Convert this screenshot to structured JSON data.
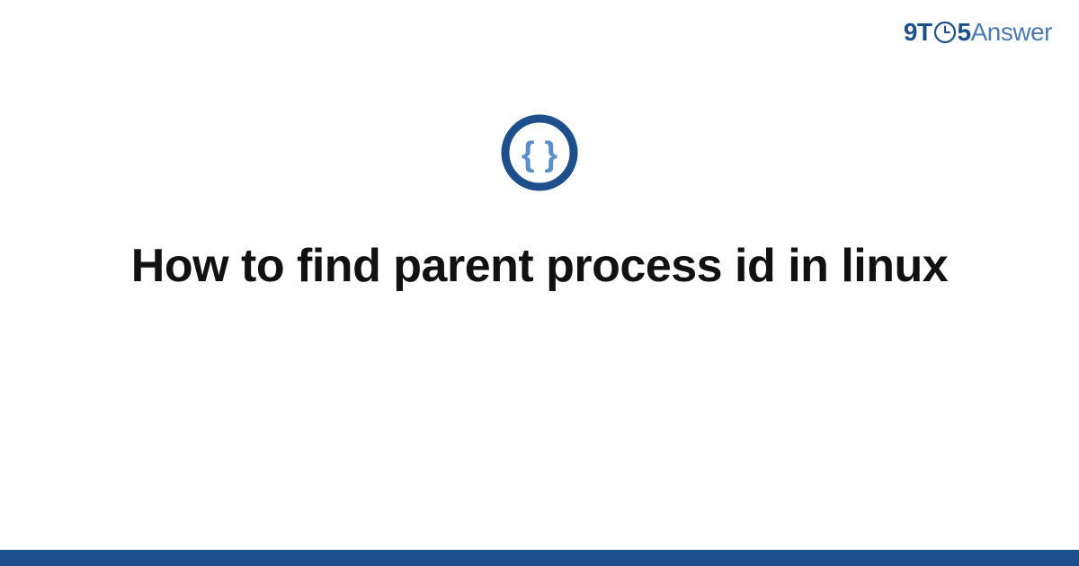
{
  "brand": {
    "part1": "9T",
    "part2": "5",
    "part3": "Answer"
  },
  "icon": {
    "name": "code-braces-icon"
  },
  "title": "How to find parent process id in linux",
  "colors": {
    "primary": "#1d4f8c",
    "secondary": "#4a7bb5",
    "brace": "#5a8fc9"
  }
}
